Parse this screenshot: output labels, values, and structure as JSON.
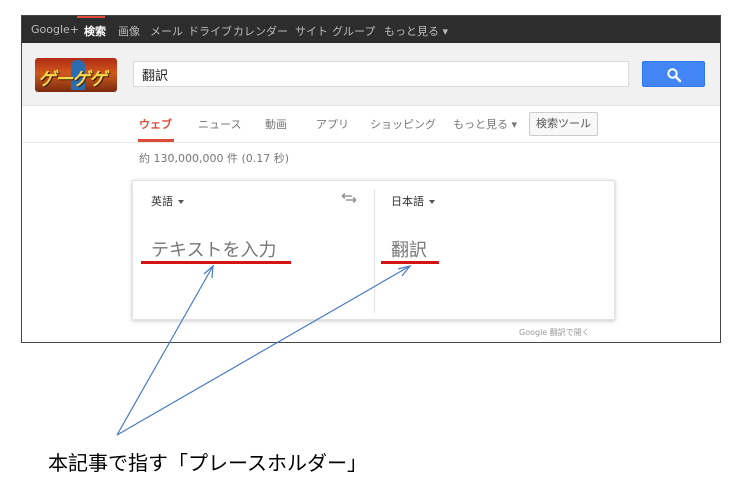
{
  "topbar": {
    "items": [
      "Google+",
      "検索",
      "画像",
      "メール",
      "ドライブ",
      "カレンダー",
      "サイト",
      "グループ",
      "もっと見る ▾"
    ],
    "active_index": 1,
    "bg_color": "#2d2d2d"
  },
  "header": {
    "doodle_text": "ゲーゲゲ",
    "search_value": "翻訳"
  },
  "tabs": {
    "items": [
      "ウェブ",
      "ニュース",
      "動画",
      "アプリ",
      "ショッピング",
      "もっと見る ▾"
    ],
    "active_index": 0,
    "tool_button": "検索ツール",
    "accent_color": "#dd4b39"
  },
  "stats": "約 130,000,000 件 (0.17 秒)",
  "translate": {
    "source_lang": "英語",
    "target_lang": "日本語",
    "source_placeholder": "テキストを入力",
    "target_placeholder": "翻訳",
    "footer_link": "Google 翻訳で開く"
  },
  "annotation": {
    "caption": "本記事で指す「プレースホルダー」",
    "underline_color": "#d51313",
    "arrow_color": "#4a7ac8"
  }
}
